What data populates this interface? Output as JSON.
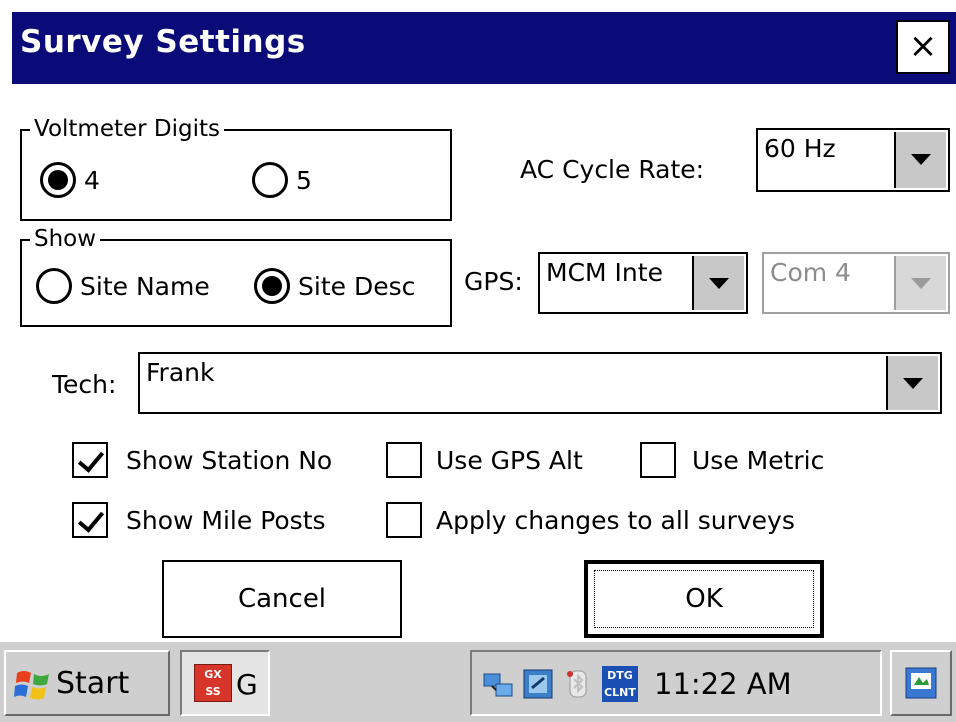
{
  "window": {
    "title": "Survey Settings",
    "close_label": "×"
  },
  "voltmeter": {
    "legend": "Voltmeter Digits",
    "options": [
      {
        "label": "4",
        "selected": true
      },
      {
        "label": "5",
        "selected": false
      }
    ]
  },
  "show": {
    "legend": "Show",
    "options": [
      {
        "label": "Site Name",
        "selected": false
      },
      {
        "label": "Site Desc",
        "selected": true
      }
    ]
  },
  "ac_cycle": {
    "label": "AC Cycle Rate:",
    "value": "60 Hz"
  },
  "gps": {
    "label": "GPS:",
    "device": "MCM Inte",
    "port": "Com 4",
    "port_enabled": false
  },
  "tech": {
    "label": "Tech:",
    "value": "Frank"
  },
  "checkboxes": [
    {
      "label": "Show Station No",
      "checked": true
    },
    {
      "label": "Use GPS Alt",
      "checked": false
    },
    {
      "label": "Use Metric",
      "checked": false
    },
    {
      "label": "Show Mile Posts",
      "checked": true
    },
    {
      "label": "Apply changes to all surveys",
      "checked": false
    }
  ],
  "buttons": {
    "cancel": "Cancel",
    "ok": "OK"
  },
  "taskbar": {
    "start_label": "Start",
    "task_icon_text": "GX SS",
    "task_label": "G",
    "tray_badge_text": "DTG CLNT",
    "clock": "11:22 AM"
  },
  "colors": {
    "titlebar": "#0a0a78",
    "taskbar": "#cfcfcf",
    "button_face": "#c8c8c8"
  }
}
